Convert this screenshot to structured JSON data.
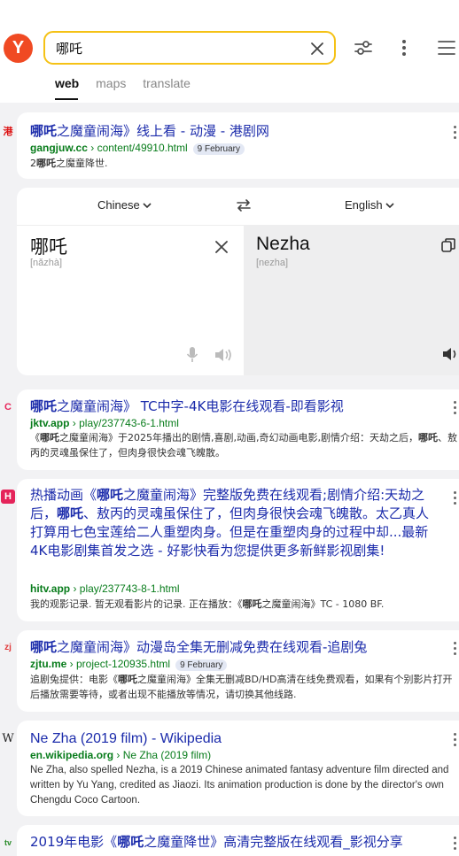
{
  "search": {
    "query": "哪吒"
  },
  "logo": {
    "letter": "Y"
  },
  "tabs": [
    {
      "label": "web",
      "active": true
    },
    {
      "label": "maps",
      "active": false
    },
    {
      "label": "translate",
      "active": false
    }
  ],
  "results": [
    {
      "favicon": "港",
      "title_hl": "哪吒",
      "title_rest": "之魔童闹海》线上看 - 动漫 - 港剧网",
      "domain": "gangjuw.cc",
      "path": " › content/49910.html",
      "date": "9 February",
      "snippet_pre": "2",
      "snippet_hl": "哪吒",
      "snippet_post": "之魔童降世."
    },
    {
      "favicon": "C",
      "title_hl": "哪吒",
      "title_rest": "之魔童闹海》 TC中字-4K电影在线观看-即看影视",
      "domain": "jktv.app",
      "path": " › play/237743-6-1.html",
      "snippet_1": "《",
      "snippet_hl1": "哪吒",
      "snippet_2": "之魔童闹海》于2025年播出的剧情,喜剧,动画,奇幻动画电影,剧情介绍：天劫之后，",
      "snippet_hl2": "哪吒",
      "snippet_3": "、敖丙的灵魂虽保住了，但肉身很快会魂飞魄散。"
    },
    {
      "favicon": "H",
      "title_1": "热播动画《",
      "title_hl1": "哪吒",
      "title_2": "之魔童闹海》完整版免费在线观看;剧情介绍:天劫之后，",
      "title_hl2": "哪吒",
      "title_3": "、敖丙的灵魂虽保住了，但肉身很快会魂飞魄散。太乙真人打算用七色宝莲给二人重塑肉身。但是在重塑肉身的过程中却...最新4K电影剧集首发之选 - 好影快看为您提供更多新鲜影视剧集!",
      "domain": "hitv.app",
      "path": " › play/237743-8-1.html",
      "snippet_1": "我的观影记录. 暂无观看影片的记录. 正在播放：《",
      "snippet_hl": "哪吒",
      "snippet_2": "之魔童闹海》TC - 1080 BF."
    },
    {
      "favicon": "zj",
      "title_hl": "哪吒",
      "title_rest": "之魔童闹海》动漫岛全集无删减免费在线观看-追剧兔",
      "domain": "zjtu.me",
      "path": " › project-120935.html",
      "date": "9 February",
      "snippet_1": "追剧兔提供：电影《",
      "snippet_hl": "哪吒",
      "snippet_2": "之魔童闹海》全集无删减BD/HD高清在线免费观看，如果有个别影片打开后播放需要等待，或者出现不能播放等情况，请切换其他线路."
    },
    {
      "favicon": "W",
      "title": "Ne Zha (2019 film) - Wikipedia",
      "domain": "en.wikipedia.org",
      "path": " › Ne Zha (2019 film)",
      "snippet": "Ne Zha, also spelled Nezha, is a 2019 Chinese animated fantasy adventure film directed and written by Yu Yang, credited as Jiaozi. Its animation production is done by the director's own Chengdu Coco Cartoon."
    },
    {
      "favicon": "tv",
      "title_1": "2019年电影《",
      "title_hl": "哪吒",
      "title_2": "之魔童降世》高清完整版在线观看_影视分享"
    }
  ],
  "translator": {
    "source_lang": "Chinese",
    "target_lang": "English",
    "source_text": "哪吒",
    "source_pinyin": "[nǎzhà]",
    "target_text": "Nezha",
    "target_pron": "[nezha]"
  },
  "colors": {
    "accent_yellow": "#f5c216",
    "link_blue": "#1b2bab",
    "url_green": "#087c1b",
    "logo_red": "#f04a23"
  }
}
